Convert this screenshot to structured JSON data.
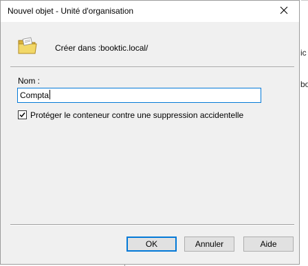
{
  "window": {
    "title": "Nouvel objet - Unité d'organisation"
  },
  "header": {
    "create_in_label": "Créer dans :",
    "create_in_value": "booktic.local/"
  },
  "form": {
    "name_label": "Nom :",
    "name_value": "Compta",
    "protect_checked": true,
    "protect_label": "Protéger le conteneur contre une suppression accidentelle"
  },
  "buttons": {
    "ok": "OK",
    "cancel": "Annuler",
    "help": "Aide"
  },
  "background": {
    "frag1": "ic",
    "frag2": "bo"
  },
  "icons": {
    "header": "folder-ou-icon",
    "close": "close-icon",
    "check": "checkmark-icon"
  },
  "colors": {
    "focus": "#0078d7",
    "dialog_bg": "#f0f0f0",
    "folder": "#e8c94a"
  }
}
